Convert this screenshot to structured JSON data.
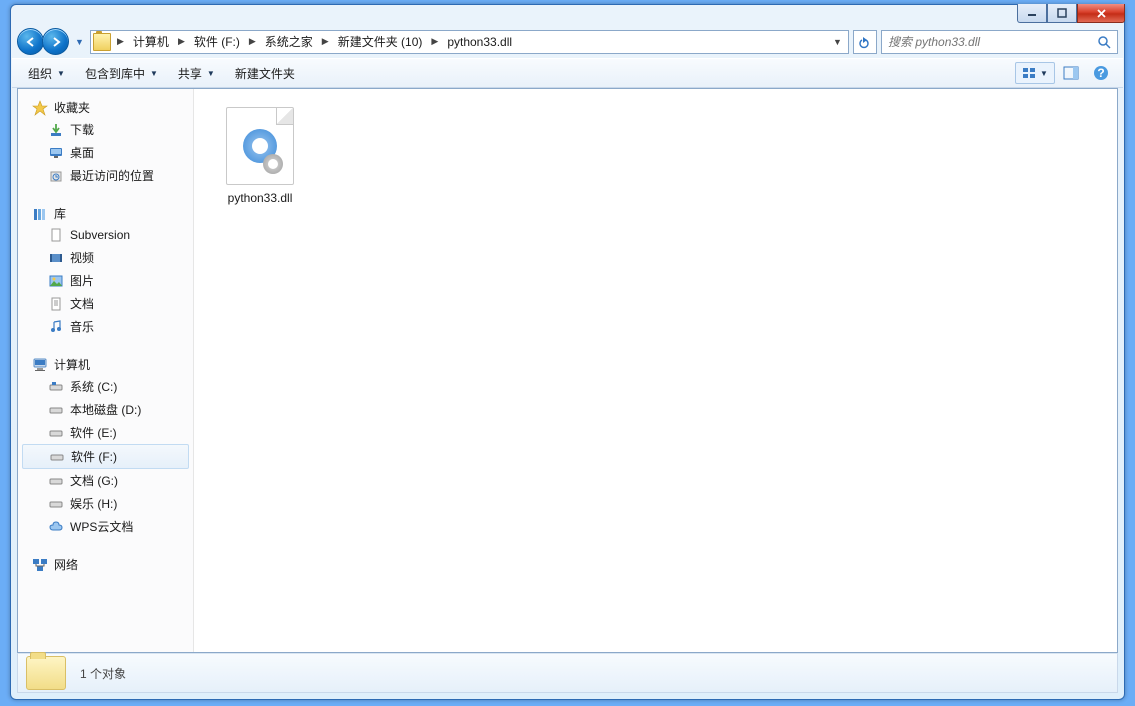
{
  "breadcrumbs": [
    "计算机",
    "软件 (F:)",
    "系统之家",
    "新建文件夹 (10)",
    "python33.dll"
  ],
  "search": {
    "placeholder": "搜索 python33.dll"
  },
  "toolbar": {
    "organize": "组织",
    "include": "包含到库中",
    "share": "共享",
    "new_folder": "新建文件夹"
  },
  "sidebar": {
    "favorites": {
      "header": "收藏夹",
      "items": [
        "下载",
        "桌面",
        "最近访问的位置"
      ]
    },
    "libraries": {
      "header": "库",
      "items": [
        "Subversion",
        "视频",
        "图片",
        "文档",
        "音乐"
      ]
    },
    "computer": {
      "header": "计算机",
      "items": [
        "系统 (C:)",
        "本地磁盘 (D:)",
        "软件 (E:)",
        "软件 (F:)",
        "文档 (G:)",
        "娱乐 (H:)",
        "WPS云文档"
      ],
      "selected_index": 3
    },
    "network": {
      "header": "网络"
    }
  },
  "files": [
    {
      "name": "python33.dll"
    }
  ],
  "status": {
    "count_text": "1 个对象"
  }
}
